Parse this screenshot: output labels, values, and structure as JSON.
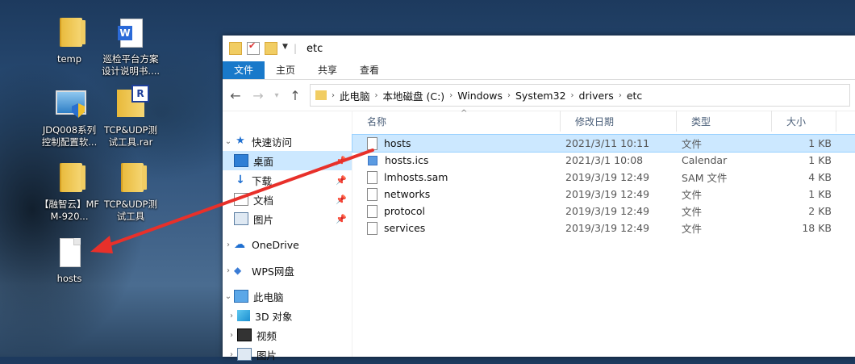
{
  "desktop": {
    "icons": [
      {
        "label": "temp"
      },
      {
        "label": "巡检平台方案设计说明书...."
      },
      {
        "label": "JDQ008系列控制配置软..."
      },
      {
        "label": "TCP&UDP测试工具.rar"
      },
      {
        "label": "【融智云】MFM-920..."
      },
      {
        "label": "TCP&UDP测试工具"
      },
      {
        "label": "hosts"
      }
    ]
  },
  "window": {
    "title": "etc",
    "ribbon_tabs": [
      "文件",
      "主页",
      "共享",
      "查看"
    ],
    "breadcrumb": [
      "此电脑",
      "本地磁盘 (C:)",
      "Windows",
      "System32",
      "drivers",
      "etc"
    ]
  },
  "nav": {
    "quick_access": "快速访问",
    "quick_items": [
      "桌面",
      "下载",
      "文档",
      "图片"
    ],
    "onedrive": "OneDrive",
    "wps": "WPS网盘",
    "this_pc": "此电脑",
    "pc_items": [
      "3D 对象",
      "视频",
      "图片"
    ]
  },
  "columns": {
    "name": "名称",
    "date": "修改日期",
    "type": "类型",
    "size": "大小"
  },
  "files": [
    {
      "name": "hosts",
      "date": "2021/3/11 10:11",
      "type": "文件",
      "size": "1 KB"
    },
    {
      "name": "hosts.ics",
      "date": "2021/3/1 10:08",
      "type": "Calendar",
      "size": "1 KB"
    },
    {
      "name": "lmhosts.sam",
      "date": "2019/3/19 12:49",
      "type": "SAM 文件",
      "size": "4 KB"
    },
    {
      "name": "networks",
      "date": "2019/3/19 12:49",
      "type": "文件",
      "size": "1 KB"
    },
    {
      "name": "protocol",
      "date": "2019/3/19 12:49",
      "type": "文件",
      "size": "2 KB"
    },
    {
      "name": "services",
      "date": "2019/3/19 12:49",
      "type": "文件",
      "size": "18 KB"
    }
  ],
  "colors": {
    "accent": "#1979ca",
    "selection": "#cce8ff",
    "annotation_arrow": "#e8302a"
  }
}
